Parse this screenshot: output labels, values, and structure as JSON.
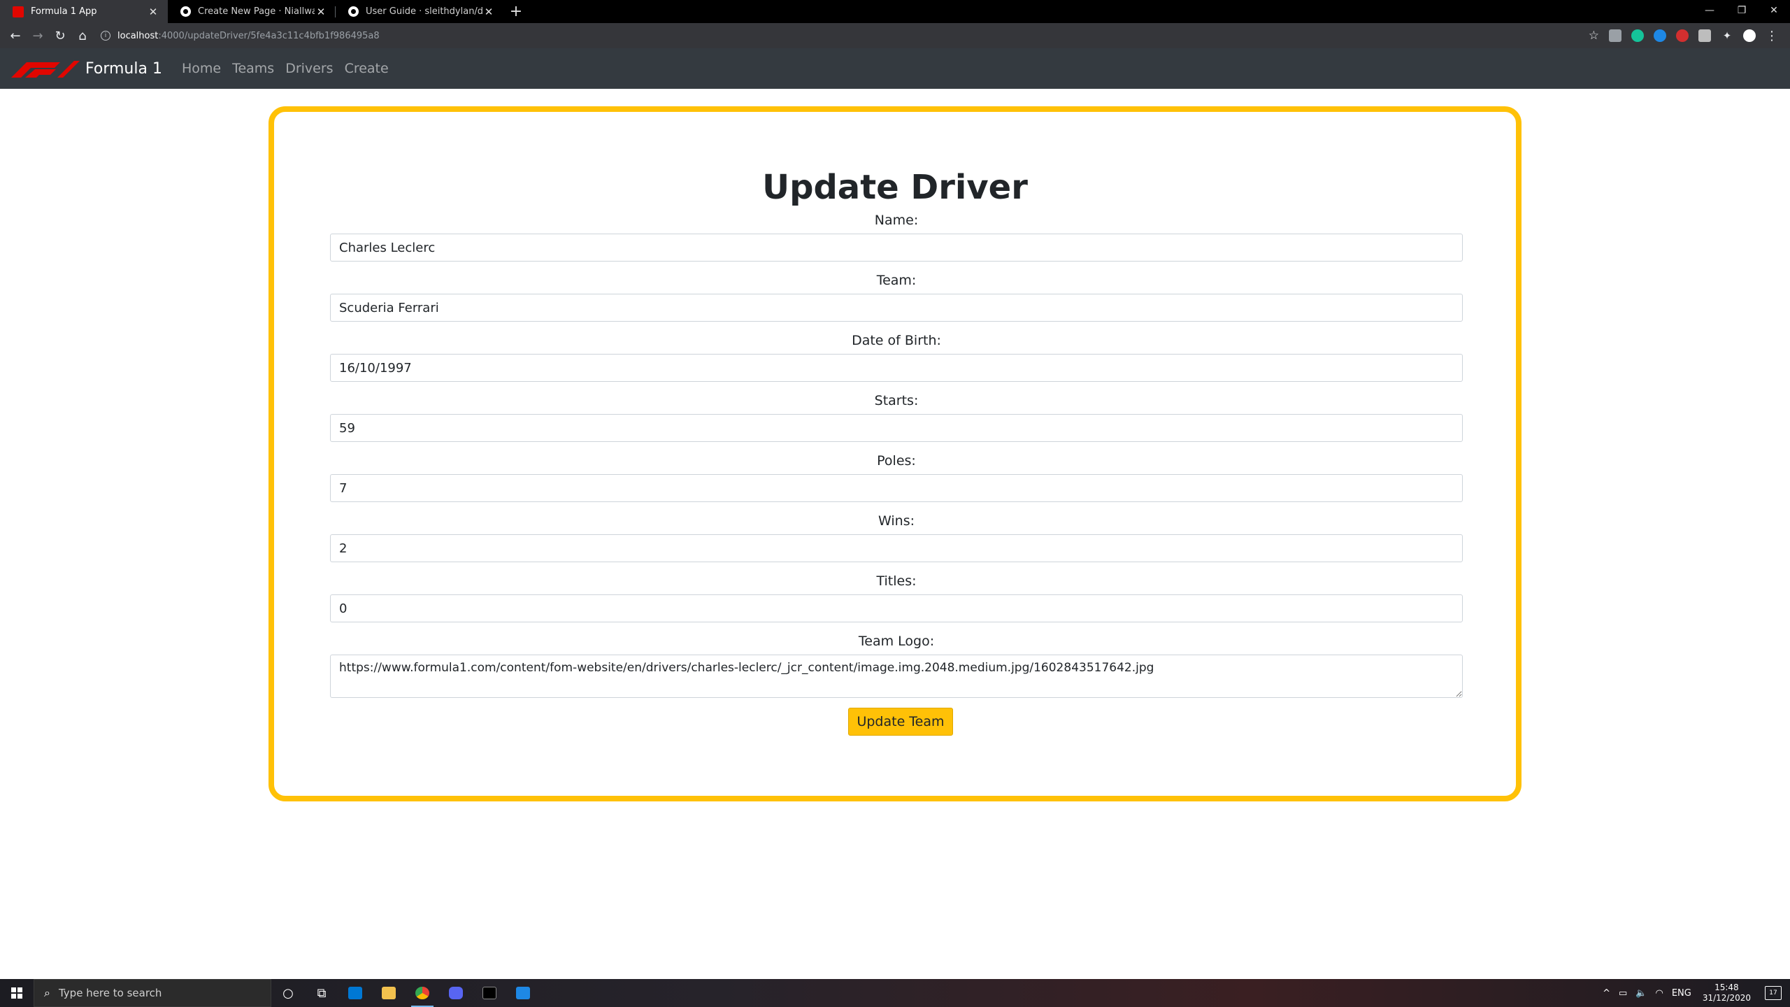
{
  "browser": {
    "tabs": [
      {
        "title": "Formula 1 App",
        "favicon": "f1-favicon-icon",
        "active": true
      },
      {
        "title": "Create New Page · Niallwalker/D",
        "favicon": "github-icon",
        "active": false
      },
      {
        "title": "User Guide · sleithdylan/data-re",
        "favicon": "github-icon",
        "active": false
      }
    ],
    "url_host": "localhost",
    "url_path": ":4000/updateDriver/5fe4a3c11c4bfb1f986495a8"
  },
  "nav": {
    "brand": "Formula 1",
    "links": [
      "Home",
      "Teams",
      "Drivers",
      "Create"
    ]
  },
  "form": {
    "title": "Update Driver",
    "fields": [
      {
        "label": "Name:",
        "value": "Charles Leclerc"
      },
      {
        "label": "Team:",
        "value": "Scuderia Ferrari"
      },
      {
        "label": "Date of Birth:",
        "value": "16/10/1997"
      },
      {
        "label": "Starts:",
        "value": "59"
      },
      {
        "label": "Poles:",
        "value": "7"
      },
      {
        "label": "Wins:",
        "value": "2"
      },
      {
        "label": "Titles:",
        "value": "0"
      }
    ],
    "logo_field": {
      "label": "Team Logo:",
      "value": "https://www.formula1.com/content/fom-website/en/drivers/charles-leclerc/_jcr_content/image.img.2048.medium.jpg/1602843517642.jpg"
    },
    "submit_label": "Update Team"
  },
  "taskbar": {
    "search_placeholder": "Type here to search",
    "language": "ENG",
    "time": "15:48",
    "date": "31/12/2020",
    "notification_count": "17"
  },
  "colors": {
    "accent": "#ffc107",
    "navbar": "#343a40",
    "f1_red": "#e10600"
  }
}
